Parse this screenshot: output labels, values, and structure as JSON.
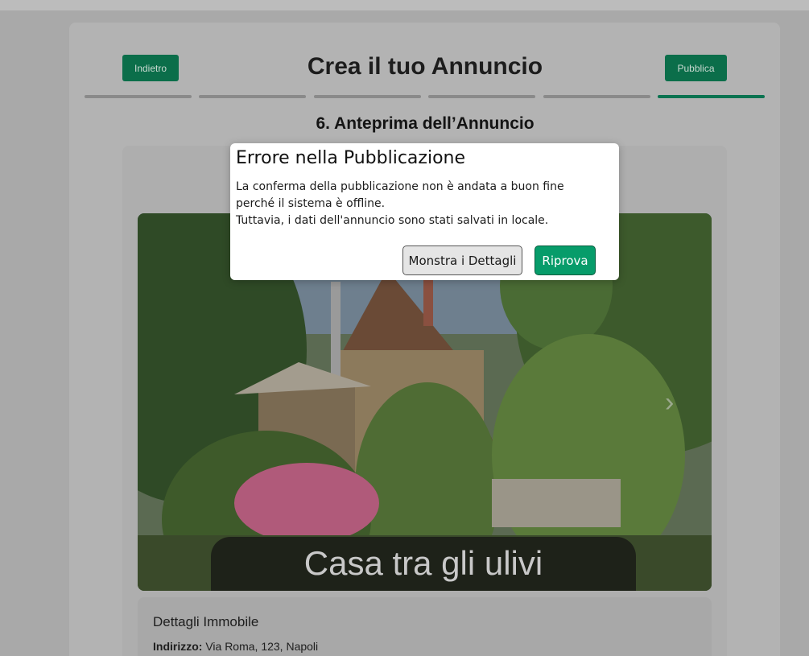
{
  "header": {
    "back_label": "Indietro",
    "title": "Crea il tuo Annuncio",
    "publish_label": "Pubblica",
    "steps_total": 6,
    "current_step": 6
  },
  "step": {
    "title": "6. Anteprima dell’Annuncio"
  },
  "preview": {
    "photo_caption": "Casa tra gli ulivi",
    "details_heading": "Dettagli Immobile",
    "address_label": "Indirizzo:",
    "address_value": "Via Roma, 123, Napoli"
  },
  "modal": {
    "title": "Errore nella Pubblicazione",
    "message_line1": "La conferma della pubblicazione non è andata a buon fine perché il sistema è offline.",
    "message_line2": "Tuttavia, i dati dell'annuncio sono stati salvati in locale.",
    "details_button": "Monstra i Dettagli",
    "retry_button": "Riprova"
  },
  "colors": {
    "accent": "#079c6a",
    "accent_dimmed": "#0b6e4a"
  },
  "icons": {
    "next": "chevron-right-icon"
  }
}
